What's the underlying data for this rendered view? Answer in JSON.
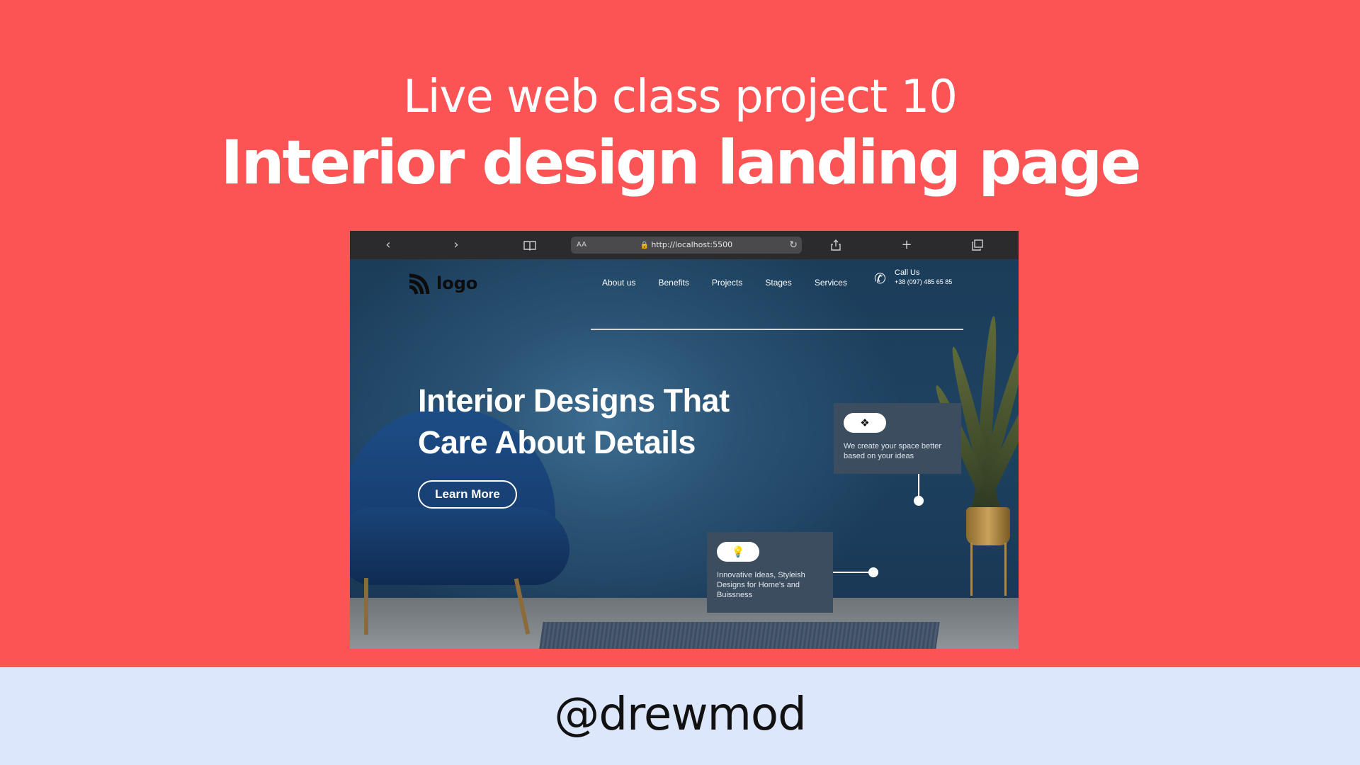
{
  "header": {
    "subtitle": "Live web class project 10",
    "title": "Interior design landing page"
  },
  "browser": {
    "url": "http://localhost:5500",
    "text_size_label": "AA",
    "icons": [
      "back-icon",
      "forward-icon",
      "bookmarks-icon",
      "lock-icon",
      "reload-icon",
      "share-icon",
      "new-tab-icon",
      "tabs-icon"
    ]
  },
  "site": {
    "logo_text": "logo",
    "nav": [
      "About us",
      "Benefits",
      "Projects",
      "Stages",
      "Services"
    ],
    "call_label": "Call Us",
    "call_phone": "+38 (097) 485 65 85",
    "hero_title_line1": "Interior Designs That",
    "hero_title_line2": "Care About Details",
    "hero_button": "Learn More",
    "cards": [
      {
        "icon": "puzzle-icon",
        "text": "We create your space better based on your ideas"
      },
      {
        "icon": "lightbulb-icon",
        "text": "Innovative Ideas, Styleish Designs for Home's and Buissness"
      }
    ]
  },
  "footer": {
    "handle": "@drewmod"
  },
  "colors": {
    "background": "#fc5454",
    "footer_background": "#dde7fb",
    "hero_background": "#1d3b57"
  }
}
